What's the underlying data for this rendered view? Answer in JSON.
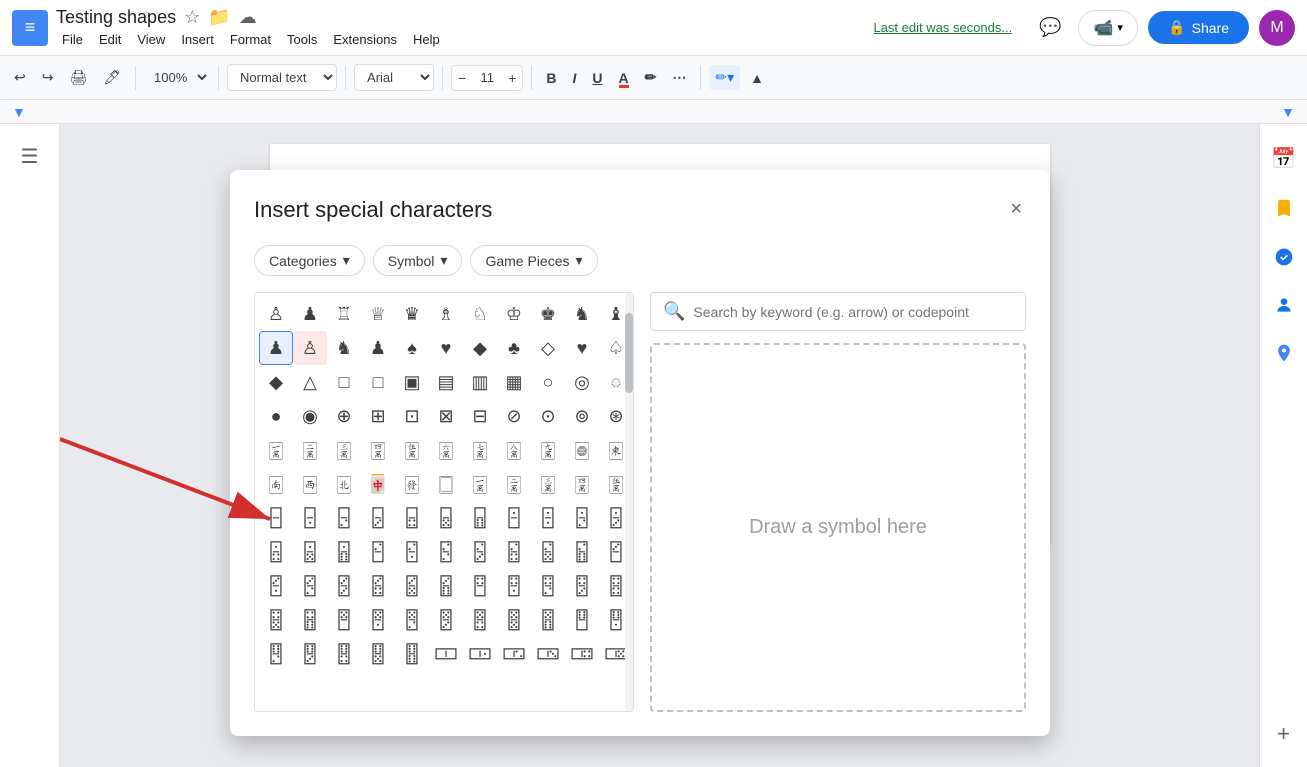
{
  "app": {
    "logo_letter": "≡",
    "title": "Testing shapes",
    "last_edit": "Last edit was seconds..."
  },
  "menu": {
    "items": [
      "File",
      "Edit",
      "View",
      "Insert",
      "Format",
      "Tools",
      "Extensions",
      "Help"
    ]
  },
  "toolbar": {
    "undo_label": "↩",
    "redo_label": "↪",
    "print_label": "🖨",
    "paint_format": "🖊",
    "zoom_value": "100%",
    "style_value": "Normal text",
    "font_value": "Arial",
    "font_size": "11",
    "bold": "B",
    "italic": "I",
    "underline": "U",
    "font_color": "A",
    "highlight": "✏",
    "more": "⋯",
    "edit_pencil": "✏"
  },
  "dialog": {
    "title": "Insert special characters",
    "close": "×",
    "filters": [
      {
        "label": "Categories",
        "has_dropdown": true
      },
      {
        "label": "Symbol",
        "has_dropdown": true
      },
      {
        "label": "Game Pieces",
        "has_dropdown": true
      }
    ],
    "search_placeholder": "Search by keyword (e.g. arrow) or codepoint",
    "draw_placeholder": "Draw a symbol here"
  },
  "symbols": {
    "chess_row1": [
      "♙",
      "♟",
      "♖",
      "♕",
      "♛",
      "♗",
      "♘",
      "♔",
      "♚",
      "♞",
      "♝"
    ],
    "chess_row2": [
      "♟",
      "♙",
      "♞",
      "♟",
      "♠",
      "♥",
      "◆",
      "♣",
      "◇",
      "♥",
      ""
    ],
    "chess_row3": [
      "◆",
      "△",
      "□",
      "□",
      "□",
      "□",
      "□",
      "□",
      "○",
      "◎",
      ""
    ],
    "chess_row4": [
      "●",
      "◉",
      "⊕",
      "⊞",
      "⊡",
      "⊠",
      "⊟",
      "⊘",
      "⊙",
      "⊚",
      ""
    ],
    "misc_rows": 8
  },
  "right_sidebar": {
    "calendar_icon": "📅",
    "keep_icon": "📝",
    "tasks_icon": "✓",
    "contacts_icon": "👤",
    "maps_icon": "📍"
  }
}
